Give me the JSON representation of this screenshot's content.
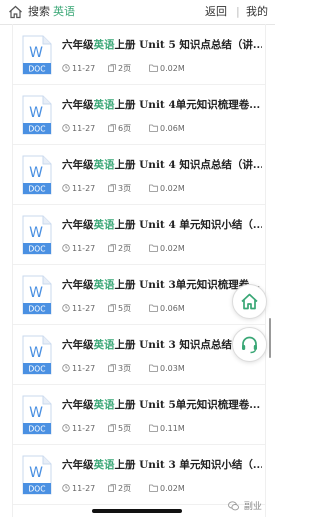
{
  "header": {
    "search_label": "搜索",
    "keyword": "英语",
    "back_label": "返回",
    "separator": "|",
    "mine_label": "我的",
    "icon": "home-outline-icon"
  },
  "doc_icon": {
    "letter": "W",
    "badge": "DOC",
    "color": "#4a90e2"
  },
  "accent_color": "#3aa776",
  "items": [
    {
      "pre": "六年级",
      "kw": "英语",
      "post": "上册 Unit 5 知识点总结（讲...",
      "date": "11-27",
      "pages": "2页",
      "size": "0.02M"
    },
    {
      "pre": "六年级",
      "kw": "英语",
      "post": "上册 Unit 4单元知识梳理卷...",
      "date": "11-27",
      "pages": "6页",
      "size": "0.06M"
    },
    {
      "pre": "六年级",
      "kw": "英语",
      "post": "上册 Unit 4 知识点总结（讲...",
      "date": "11-27",
      "pages": "3页",
      "size": "0.02M"
    },
    {
      "pre": "六年级",
      "kw": "英语",
      "post": "上册 Unit 4 单元知识小结（...",
      "date": "11-27",
      "pages": "2页",
      "size": "0.02M"
    },
    {
      "pre": "六年级",
      "kw": "英语",
      "post": "上册 Unit 3单元知识梳理卷...",
      "date": "11-27",
      "pages": "5页",
      "size": "0.06M"
    },
    {
      "pre": "六年级",
      "kw": "英语",
      "post": "上册 Unit 3 知识点总结（讲...",
      "date": "11-27",
      "pages": "3页",
      "size": "0.03M"
    },
    {
      "pre": "六年级",
      "kw": "英语",
      "post": "上册 Unit 5单元知识梳理卷...",
      "date": "11-27",
      "pages": "5页",
      "size": "0.11M"
    },
    {
      "pre": "六年级",
      "kw": "英语",
      "post": "上册 Unit 3 单元知识小结（...",
      "date": "11-27",
      "pages": "2页",
      "size": "0.02M"
    }
  ],
  "floating": {
    "home_icon": "home-icon",
    "service_icon": "headset-icon"
  },
  "watermark": {
    "text": "副业",
    "icon": "wechat-icon"
  }
}
